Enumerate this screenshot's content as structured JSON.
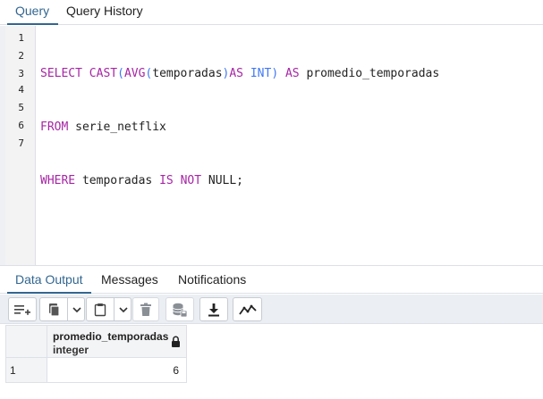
{
  "tabs": {
    "query": "Query",
    "query_history": "Query History"
  },
  "editor": {
    "line_numbers": [
      "1",
      "2",
      "3",
      "4",
      "5",
      "6",
      "7"
    ],
    "line1": {
      "select": "SELECT",
      "cast": "CAST",
      "p1": "(",
      "avg": "AVG",
      "p2": "(",
      "col": "temporadas",
      "p3": ")",
      "as1": "AS",
      "int": "INT",
      "p4": ")",
      "as2": "AS",
      "alias": "promedio_temporadas"
    },
    "line2": {
      "from": "FROM",
      "table": "serie_netflix"
    },
    "line3": {
      "where": "WHERE",
      "col": "temporadas",
      "is": "IS",
      "not": "NOT",
      "null": "NULL;"
    }
  },
  "results": {
    "tabs": {
      "data_output": "Data Output",
      "messages": "Messages",
      "notifications": "Notifications"
    },
    "columns": [
      {
        "name": "promedio_temporadas",
        "type": "integer"
      }
    ],
    "rows": [
      {
        "num": "1",
        "value": "6"
      }
    ]
  },
  "colors": {
    "accent": "#326690",
    "keyword": "#a626a4",
    "type": "#4078f2",
    "toolbar_bg": "#ebeef3"
  },
  "icons": [
    "add-row-icon",
    "copy-icon",
    "chevron-down-icon",
    "paste-icon",
    "chevron-down-icon",
    "delete-icon",
    "save-data-icon",
    "download-icon",
    "graph-icon",
    "lock-icon"
  ]
}
